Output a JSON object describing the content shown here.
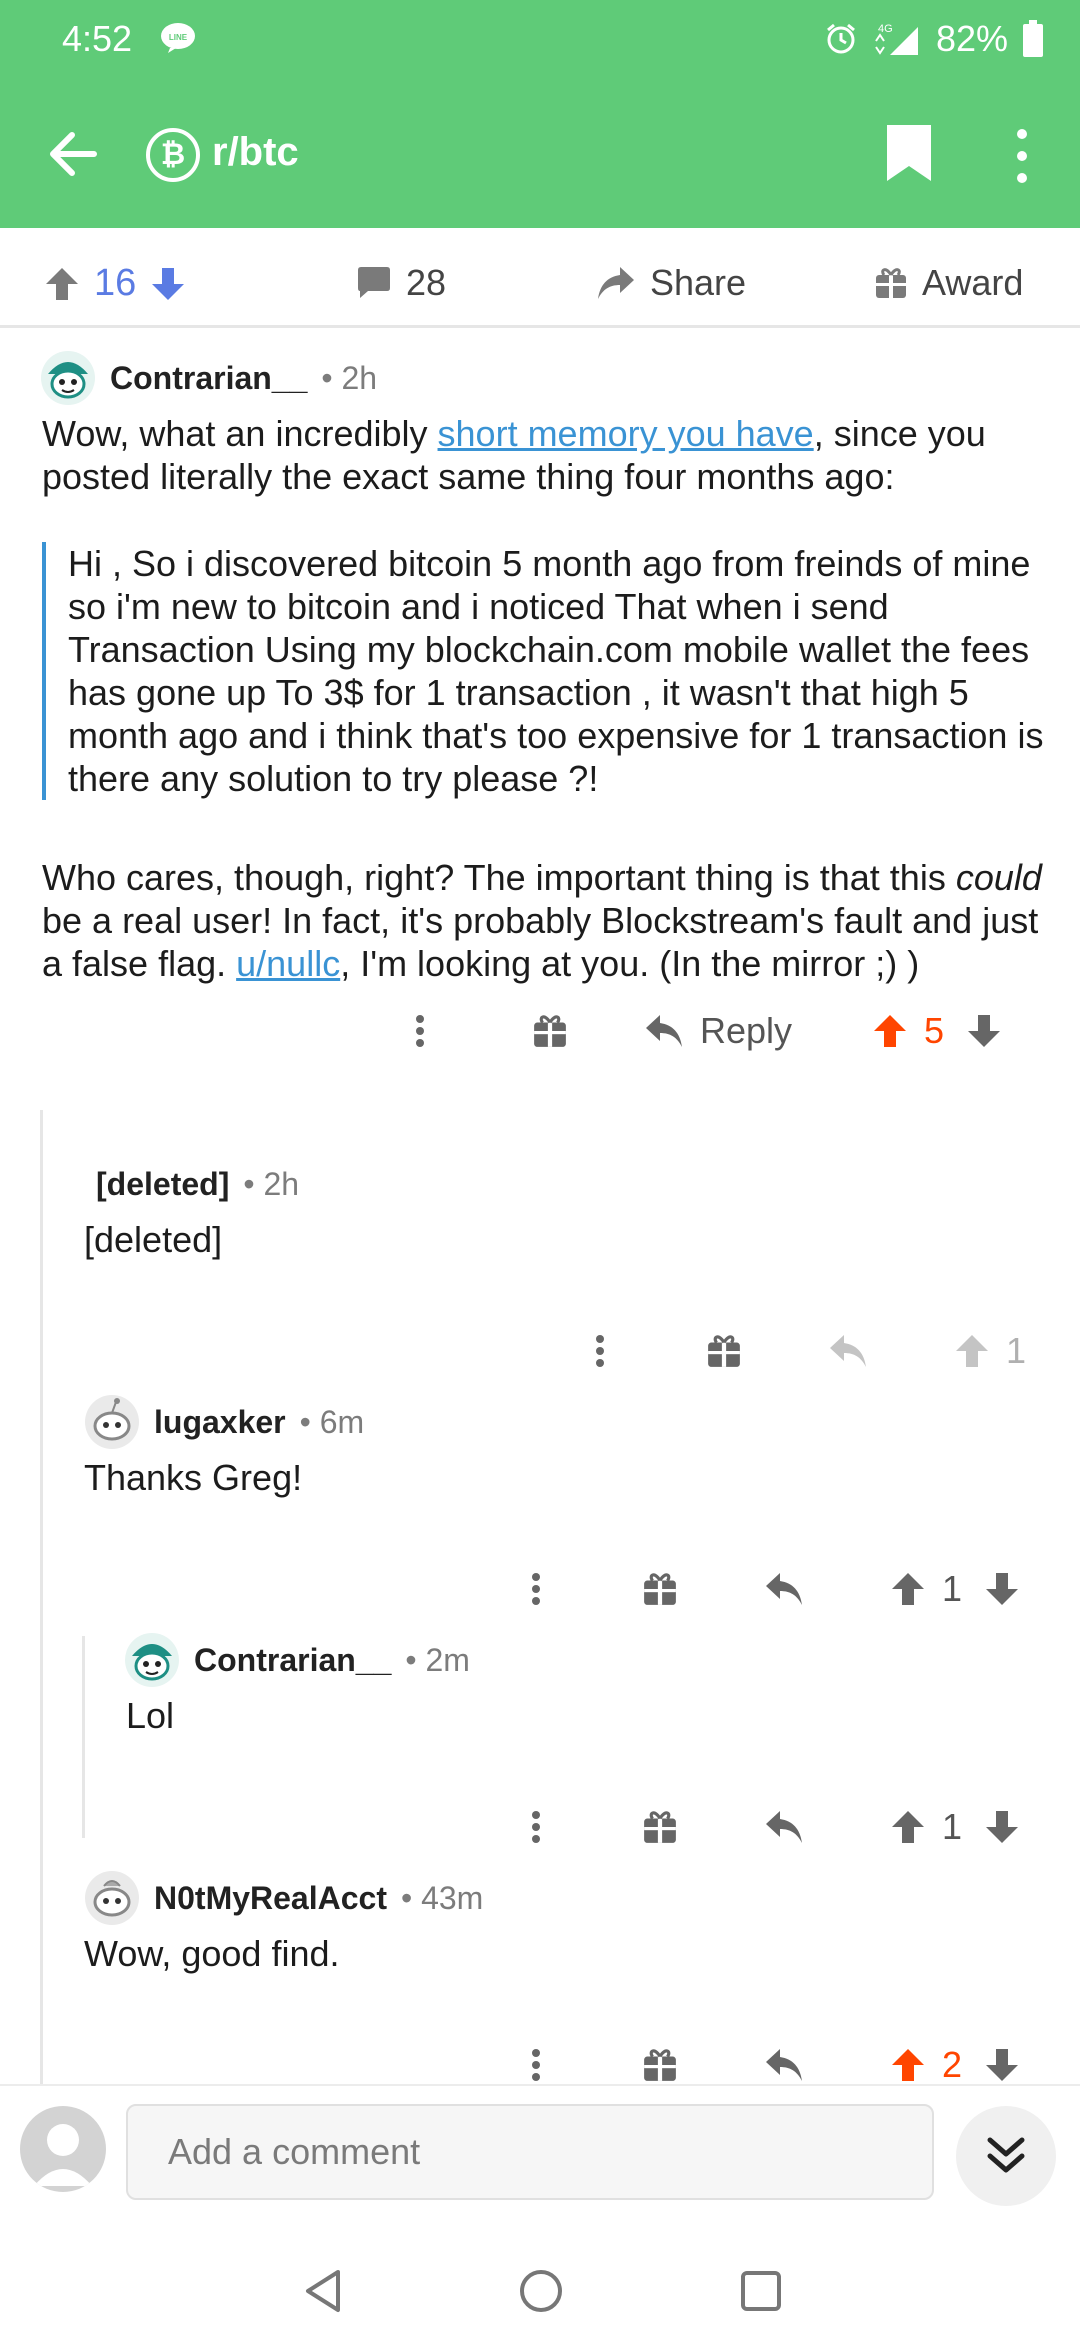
{
  "status": {
    "time": "4:52",
    "line_icon": "line-icon",
    "signal": "4G",
    "battery": "82%"
  },
  "appbar": {
    "subreddit": "r/btc",
    "back_icon": "back-arrow-icon",
    "bookmark_icon": "bookmark-icon",
    "more_icon": "more-vert-icon"
  },
  "post_actions": {
    "vote_count": "16",
    "comment_count": "28",
    "share_label": "Share",
    "award_label": "Award"
  },
  "colors": {
    "header": "#5fcb78",
    "link": "#3a93d4",
    "upvote_active": "#ff4500",
    "vote_blue": "#5a7be3"
  },
  "comments": [
    {
      "author": "Contrarian__",
      "age": "• 2h",
      "body_pre": "Wow, what an incredibly ",
      "body_link": "short memory you have",
      "body_post": ", since you posted literally the exact same thing four months ago:",
      "quote": "Hi , So i discovered bitcoin 5 month ago from freinds of mine so i'm new to bitcoin and i noticed That when i send Transaction Using my blockchain.com mobile wallet the fees has gone up To 3$ for 1 transaction , it wasn't that high 5 month ago and i think that's too expensive for 1 transaction is there any solution to try please ?!",
      "body2_pre": "Who cares, though, right? The important thing is that this ",
      "body2_em": "could",
      "body2_mid": " be a real user! In fact, it's probably Blockstream's fault and just a false flag. ",
      "body2_link": "u/nullc",
      "body2_post": ", I'm looking at you. (In the mirror ;) )",
      "reply_label": "Reply",
      "votes": "5"
    },
    {
      "author": "[deleted]",
      "age": "• 2h",
      "body": "[deleted]",
      "votes": "1"
    },
    {
      "author": "lugaxker",
      "age": "• 6m",
      "body": "Thanks Greg!",
      "votes": "1"
    },
    {
      "author": "Contrarian__",
      "age": "• 2m",
      "body": "Lol",
      "votes": "1"
    },
    {
      "author": "N0tMyRealAcct",
      "age": "• 43m",
      "body": "Wow, good find.",
      "votes": "2"
    }
  ],
  "composer": {
    "placeholder": "Add a comment",
    "expand_icon": "double-chevron-down-icon"
  },
  "nav": {
    "back": "nav-back-icon",
    "home": "nav-home-icon",
    "recents": "nav-recents-icon"
  }
}
